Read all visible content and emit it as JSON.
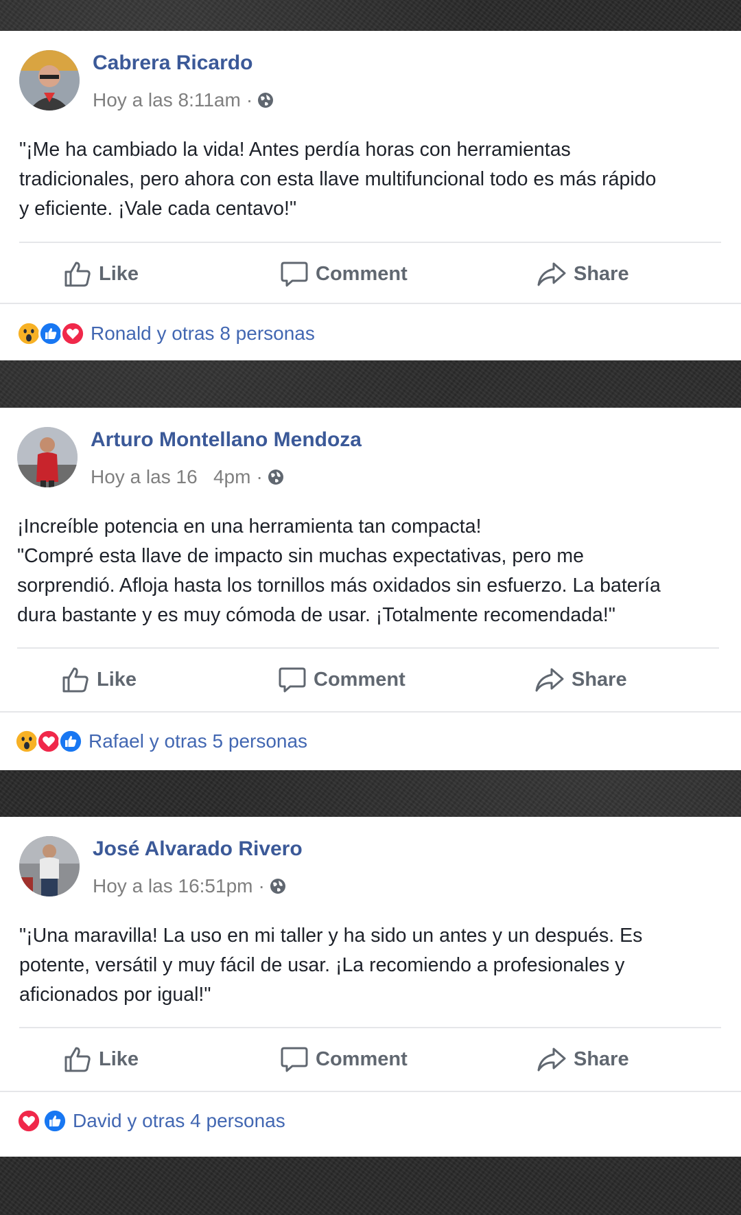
{
  "colors": {
    "author": "#3b5998",
    "meta": "#7f7f7f",
    "body": "#1d2129",
    "action": "#606770",
    "reaction_text": "#4267b2",
    "like_blue": "#1877f2",
    "love_red": "#f0284a",
    "wow_yellow": "#f7b125"
  },
  "actions": {
    "like": "Like",
    "comment": "Comment",
    "share": "Share"
  },
  "posts": [
    {
      "author": "Cabrera Ricardo",
      "time": "Hoy a las 8:11am",
      "dot": "·",
      "text": "\"¡Me ha cambiado la vida! Antes perdía horas con herramientas\ntradicionales, pero ahora con esta llave multifuncional todo es más rápido\ny eficiente. ¡Vale cada centavo!\"",
      "reactions": [
        "wow-icon",
        "like-icon",
        "love-icon"
      ],
      "reaction_text": "Ronald y otras 8 personas"
    },
    {
      "author": "Arturo Montellano Mendoza",
      "time": "Hoy a las 16   4pm",
      "dot": "·",
      "text": "¡Increíble potencia en una herramienta tan compacta!\n\"Compré esta llave de impacto sin muchas expectativas, pero me\nsorprendió. Afloja hasta los tornillos más oxidados sin esfuerzo. La batería\ndura bastante y es muy cómoda de usar. ¡Totalmente recomendada!\"",
      "reactions": [
        "wow-icon",
        "love-icon",
        "like-icon"
      ],
      "reaction_text": "Rafael y otras 5 personas"
    },
    {
      "author": "José Alvarado Rivero",
      "time": "Hoy a las 16:51pm",
      "dot": "·",
      "text": "\"¡Una maravilla! La uso en mi taller y ha sido un antes y un después. Es\npotente, versátil y muy fácil de usar. ¡La recomiendo a profesionales y\naficionados por igual!\"",
      "reactions": [
        "love-icon",
        "like-icon"
      ],
      "reaction_text": "David y otras 4 personas"
    }
  ]
}
